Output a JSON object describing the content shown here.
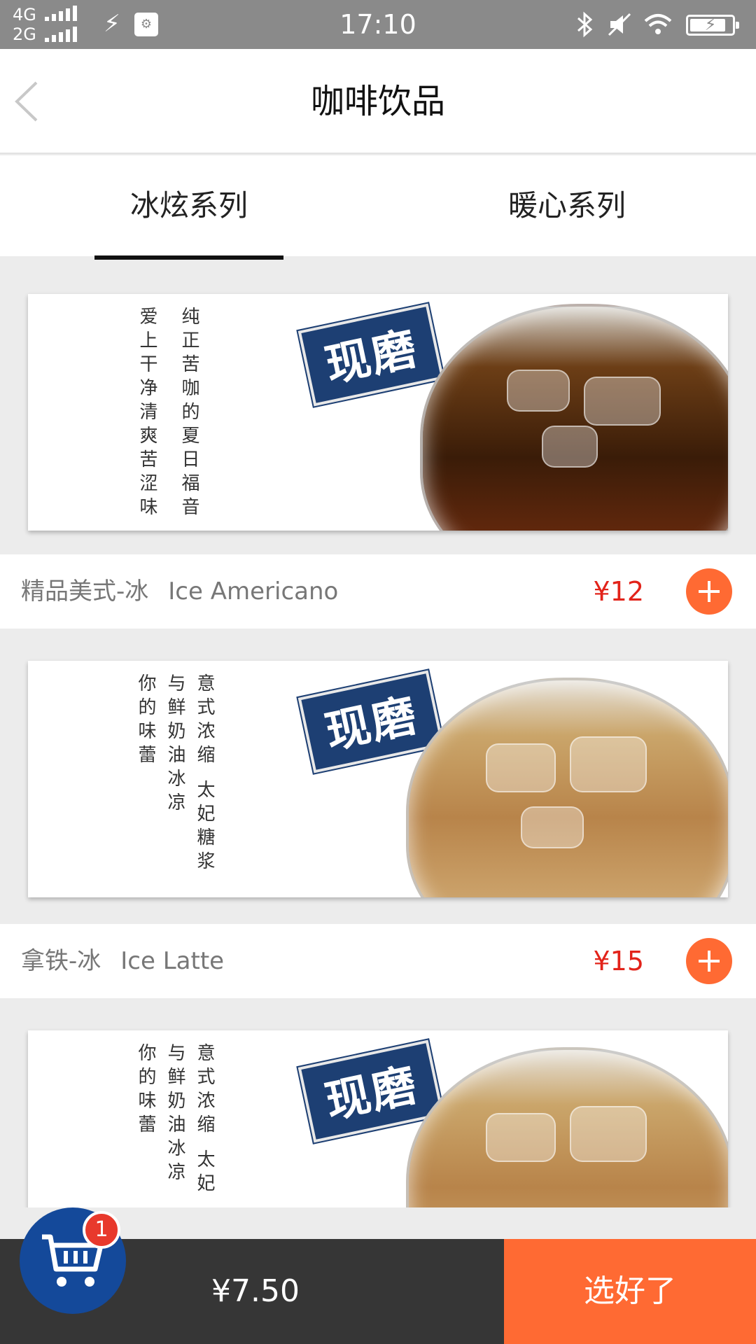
{
  "status_bar": {
    "network_1": "4G",
    "network_2": "2G",
    "time": "17:10",
    "icons": [
      "signal-icon",
      "usb-icon",
      "usb-debug-icon",
      "bluetooth-icon",
      "mute-icon",
      "wifi-icon",
      "battery-charging-icon"
    ]
  },
  "header": {
    "title": "咖啡饮品",
    "back_icon": "chevron-left-icon"
  },
  "tabs": [
    {
      "label": "冰炫系列",
      "selected": true
    },
    {
      "label": "暖心系列",
      "selected": false
    }
  ],
  "products": [
    {
      "name_cn": "精品美式-冰",
      "name_en": "Ice Americano",
      "price": "¥12",
      "banner": {
        "stamp": "现磨",
        "poem_col1": "纯正苦咖的夏日福音",
        "poem_col2": "爱上干净清爽苦涩味"
      }
    },
    {
      "name_cn": "拿铁-冰",
      "name_en": "Ice Latte",
      "price": "¥15",
      "banner": {
        "stamp": "现磨",
        "poem_col1": "意式浓缩 太妃糖浆",
        "poem_col2": "与鲜奶油冰凉",
        "poem_col3": "你的味蕾"
      }
    },
    {
      "banner": {
        "stamp": "现磨",
        "poem_col1": "意式浓缩 太妃",
        "poem_col2": "与鲜奶油冰凉",
        "poem_col3": "你的味蕾"
      }
    }
  ],
  "cart": {
    "badge_count": "1",
    "total": "¥7.50",
    "checkout_label": "选好了"
  },
  "colors": {
    "accent": "#ff6a33",
    "price": "#e2231a",
    "cart_blue": "#14499a",
    "bottom_bar": "#363636"
  }
}
